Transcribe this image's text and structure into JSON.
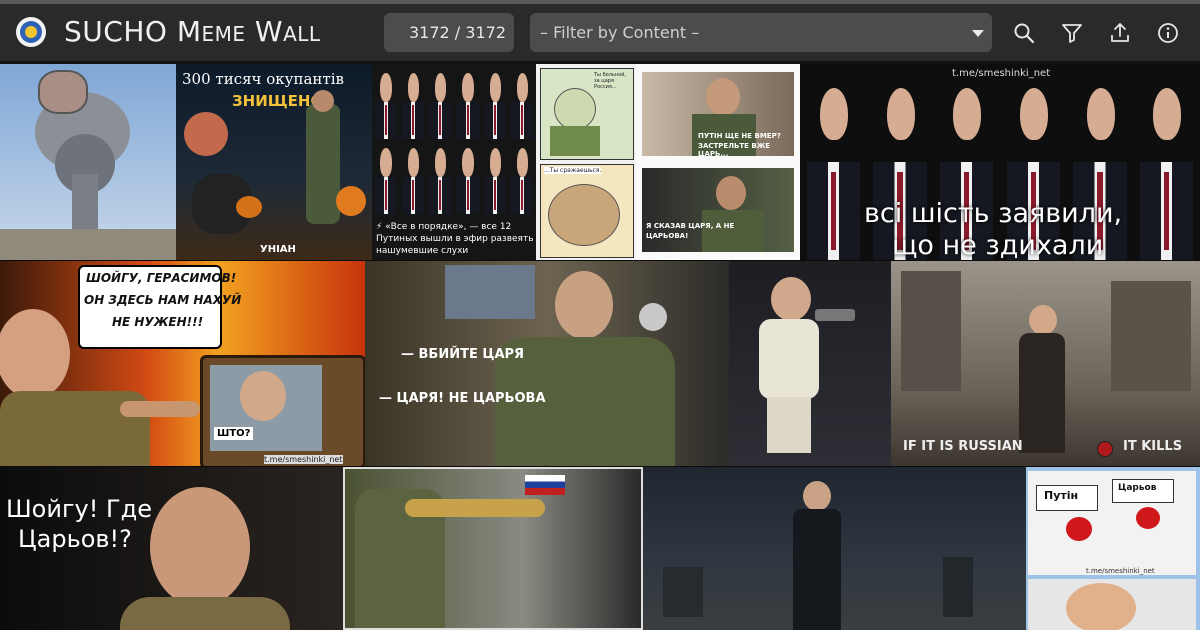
{
  "app": {
    "title_first": "SUCHO",
    "title_second": "Meme",
    "title_third": "Wall"
  },
  "counter": {
    "value": "3172 / 3172"
  },
  "filter": {
    "placeholder": "– Filter by Content –"
  },
  "icons": [
    "search-icon",
    "filter-icon",
    "upload-icon",
    "info-icon"
  ],
  "colors": {
    "header_bg": "#2a2a2a",
    "control_bg": "#4c4c4c",
    "text": "#f0f0f0"
  },
  "tiles": {
    "t2": {
      "headline": "300 тисяч окупантів",
      "subline": "ЗНИЩЕНО",
      "watermark": "УНІАН"
    },
    "t3": {
      "caption_line1": "⚡ «Все в порядке», — все 12",
      "caption_line2": "Путиных вышли в эфир развеять",
      "caption_line3": "нашумевшие слухи"
    },
    "t4": {
      "bubble_top": "Ты больной, за царя Россия...",
      "bubble_bottom": "...Ты сражаешься."
    },
    "t5": {
      "caption_top_line1": "ПУТІН ЩЕ НЕ ВМЕР?",
      "caption_top_line2": "ЗАСТРЕЛЬТЕ ВЖЕ ЦАРЬ...",
      "caption_bottom_line1": "Я СКАЗАВ ЦАРЯ, А НЕ",
      "caption_bottom_line2": "ЦАРЬОВА!"
    },
    "t6": {
      "watermark": "t.me/smeshinki_net",
      "line1": "всі шість заявили,",
      "line2": "що не здихали"
    },
    "t7": {
      "bubble_line1": "ШОЙГУ, ГЕРАСИМОВ!",
      "bubble_line2": "ОН ЗДЕСЬ НАМ НАХУЙ",
      "bubble_line3": "НЕ НУЖЕН!!!",
      "tv_label": "ШТО?",
      "watermark": "t.me/smeshinki_net"
    },
    "t8": {
      "line1": "— ВБИЙТЕ ЦАРЯ",
      "line2": "— ЦАРЯ! НЕ ЦАРЬОВА"
    },
    "t10": {
      "left": "IF IT IS RUSSIAN",
      "right": "IT KILLS"
    },
    "t11": {
      "line1": "Шойгу! Где",
      "line2": "Царьов!?"
    },
    "t14": {
      "button_left": "Путін",
      "button_right": "Царьов",
      "watermark": "t.me/smeshinki_net"
    }
  }
}
